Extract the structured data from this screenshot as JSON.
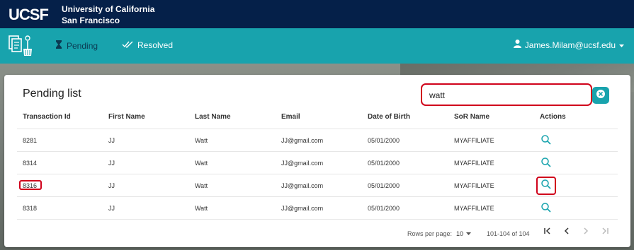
{
  "header": {
    "logo_text": "UCSF",
    "university_line1": "University of California",
    "university_line2": "San Francisco"
  },
  "nav": {
    "app_icon": "document-broom-icon",
    "pending_label": "Pending",
    "pending_icon": "hourglass-icon",
    "resolved_label": "Resolved",
    "resolved_icon": "double-check-icon",
    "user_email": "James.Milam@ucsf.edu",
    "user_icon": "person-icon"
  },
  "page": {
    "title": "Pending list",
    "search_value": "watt",
    "clear_icon": "close-circle-icon"
  },
  "table": {
    "columns": [
      "Transaction Id",
      "First Name",
      "Last Name",
      "Email",
      "Date of Birth",
      "SoR Name",
      "Actions"
    ],
    "rows": [
      {
        "id": "8281",
        "first": "JJ",
        "last": "Watt",
        "email": "JJ@gmail.com",
        "dob": "05/01/2000",
        "sor": "MYAFFILIATE"
      },
      {
        "id": "8314",
        "first": "JJ",
        "last": "Watt",
        "email": "JJ@gmail.com",
        "dob": "05/01/2000",
        "sor": "MYAFFILIATE"
      },
      {
        "id": "8316",
        "first": "JJ",
        "last": "Watt",
        "email": "JJ@gmail.com",
        "dob": "05/01/2000",
        "sor": "MYAFFILIATE"
      },
      {
        "id": "8318",
        "first": "JJ",
        "last": "Watt",
        "email": "JJ@gmail.com",
        "dob": "05/01/2000",
        "sor": "MYAFFILIATE"
      }
    ],
    "action_icon": "search-icon"
  },
  "pagination": {
    "rows_per_page_label": "Rows per page:",
    "rows_per_page_value": "10",
    "range": "101-104 of 104"
  },
  "colors": {
    "header_bg": "#052049",
    "nav_bg": "#18a3ad",
    "highlight": "#d0021b",
    "action_icon": "#18a3ad"
  }
}
